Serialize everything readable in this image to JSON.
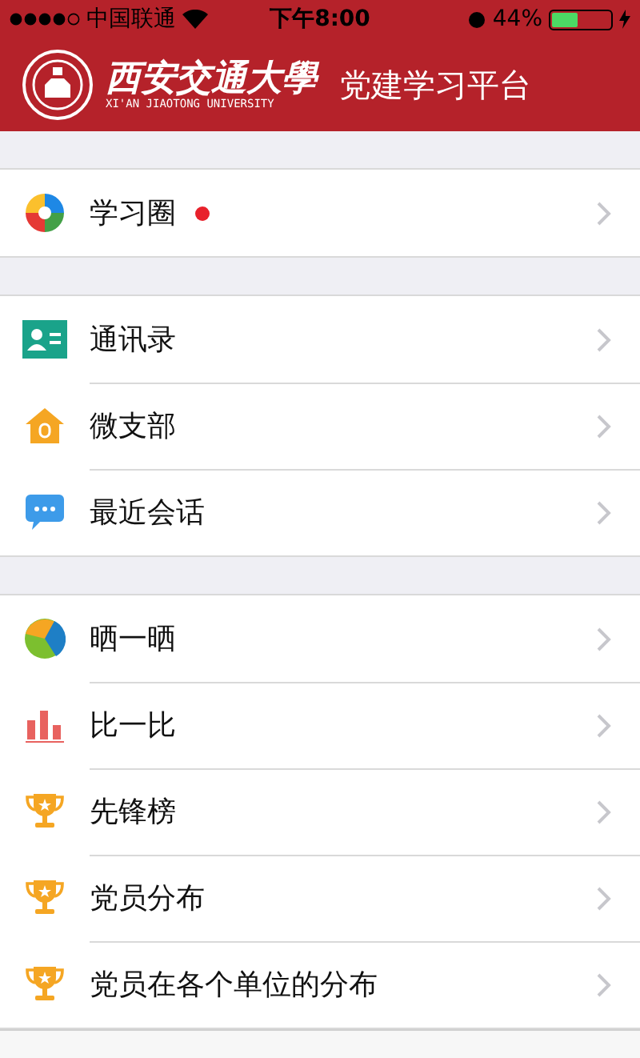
{
  "status_bar": {
    "carrier": "中国联通",
    "time": "下午8:00",
    "battery": "44%",
    "battery_meter": {
      "level": 0.44
    }
  },
  "header": {
    "logo_name": "西安交通大學",
    "logo_subtitle": "XI'AN JIAOTONG UNIVERSITY",
    "title": "党建学习平台"
  },
  "groups": [
    {
      "items": [
        {
          "kind": "circle",
          "label": "学习圈",
          "badge": true
        }
      ]
    },
    {
      "items": [
        {
          "kind": "contacts",
          "label": "通讯录",
          "badge": false
        },
        {
          "kind": "house",
          "label": "微支部",
          "badge": false
        },
        {
          "kind": "chat",
          "label": "最近会话",
          "badge": false
        }
      ]
    },
    {
      "items": [
        {
          "kind": "pie",
          "label": "晒一晒",
          "badge": false
        },
        {
          "kind": "bars",
          "label": "比一比",
          "badge": false
        },
        {
          "kind": "trophy",
          "label": "先锋榜",
          "badge": false
        },
        {
          "kind": "trophy",
          "label": "党员分布",
          "badge": false
        },
        {
          "kind": "trophy",
          "label": "党员在各个单位的分布",
          "badge": false
        }
      ]
    }
  ]
}
